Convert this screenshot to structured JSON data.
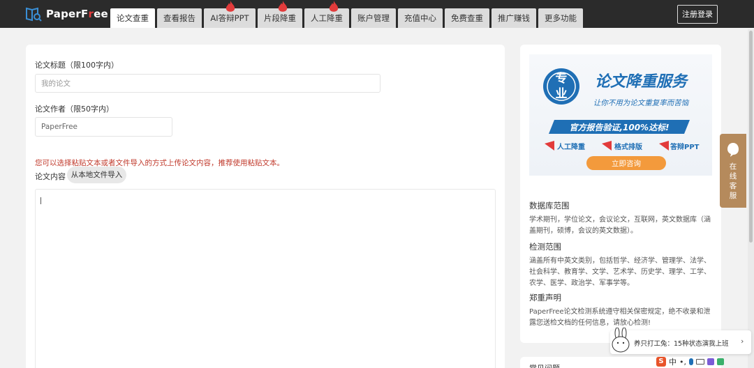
{
  "header": {
    "brand": {
      "prefix": "PaperF",
      "accent": "r",
      "suffix": "ee"
    },
    "tabs": [
      {
        "label": "论文查重",
        "active": true,
        "hot": false
      },
      {
        "label": "查看报告",
        "active": false,
        "hot": false
      },
      {
        "label": "AI答辩PPT",
        "active": false,
        "hot": true
      },
      {
        "label": "片段降重",
        "active": false,
        "hot": true
      },
      {
        "label": "人工降重",
        "active": false,
        "hot": true
      },
      {
        "label": "账户管理",
        "active": false,
        "hot": false
      },
      {
        "label": "充值中心",
        "active": false,
        "hot": false
      },
      {
        "label": "免费查重",
        "active": false,
        "hot": false
      },
      {
        "label": "推广赚钱",
        "active": false,
        "hot": false
      },
      {
        "label": "更多功能",
        "active": false,
        "hot": false
      }
    ],
    "register_label": "注册登录"
  },
  "form": {
    "title_label": "论文标题（限100字内）",
    "title_placeholder": "我的论文",
    "author_label": "论文作者（限50字内）",
    "author_value": "PaperFree",
    "hint": "您可以选择粘贴文本或者文件导入的方式上传论文内容，推荐使用粘贴文本。",
    "content_label": "论文内容",
    "import_label": "从本地文件导入"
  },
  "banner": {
    "badge_top": "专",
    "badge_bottom": "业",
    "headline": "论文降重服务",
    "tagline": "让你不用为论文重复率而苦恼",
    "ribbon": "官方报告验证,100%达标!",
    "features": [
      "人工降重",
      "格式排版",
      "答辩PPT"
    ],
    "cta": "立即咨询"
  },
  "sidebar": {
    "db_title": "数据库范围",
    "db_text": "学术期刊，学位论文，会议论文，互联网，英文数据库（涵盖期刊，硕博，会议的英文数据）。",
    "scope_title": "检测范围",
    "scope_text": "涵盖所有中英文类别，包括哲学、经济学、管理学、法学、社会科学、教育学、文学、艺术学、历史学、理学、工学、农学、医学、政治学、军事学等。",
    "notice_title": "郑重声明",
    "notice_text": "PaperFree论文检测系统遵守相关保密规定，绝不收录和泄露您送检文档的任何信息，请放心检测!",
    "faq_title": "常见问题"
  },
  "service": {
    "label": "在线客服"
  },
  "notification": {
    "text": "养只打工兔：15种状态演我上班"
  },
  "ime": {
    "mode": "中"
  },
  "colors": {
    "topbar": "#2b2b2b",
    "accent_red": "#e23b3b",
    "banner_blue": "#1f6fb5",
    "cta_orange": "#f39a3c",
    "service_brown": "#b58a5c"
  }
}
